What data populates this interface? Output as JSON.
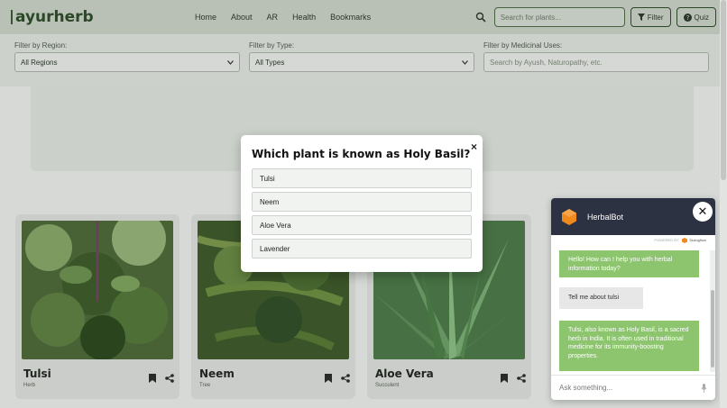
{
  "brand": {
    "name": "ayurherb"
  },
  "nav": {
    "links": [
      "Home",
      "About",
      "AR",
      "Health",
      "Bookmarks"
    ],
    "search_placeholder": "Search for plants...",
    "filter_label": "Filter",
    "quiz_label": "Quiz"
  },
  "filters": {
    "region": {
      "label": "Filter by Region:",
      "value": "All Regions"
    },
    "type": {
      "label": "Filter by Type:",
      "value": "All Types"
    },
    "uses": {
      "label": "Filter by Medicinal Uses:",
      "placeholder": "Search by Ayush, Naturopathy, etc."
    }
  },
  "cards": [
    {
      "name": "Tulsi",
      "type": "Herb"
    },
    {
      "name": "Neem",
      "type": "Tree"
    },
    {
      "name": "Aloe Vera",
      "type": "Succulent"
    }
  ],
  "quiz": {
    "question": "Which plant is known as Holy Basil?",
    "close": "×",
    "options": [
      "Tulsi",
      "Neem",
      "Aloe Vera",
      "Lavender"
    ]
  },
  "chatbot": {
    "title": "HerbalBot",
    "powered_by": "POWERED BY",
    "powered_brand": "Dialogflow",
    "messages": [
      {
        "from": "bot",
        "text": "Hello! How can I help you with herbal information today?"
      },
      {
        "from": "user",
        "text": "Tell me about tulsi"
      },
      {
        "from": "bot",
        "text": "Tulsi, also known as Holy Basil, is a sacred herb in India. It is often used in traditional medicine for its immunity-boosting properties."
      }
    ],
    "input_placeholder": "Ask something..."
  },
  "colors": {
    "accent": "#2f4f2a",
    "chat_header": "#2d3243",
    "bot_bubble": "#8cc56d"
  }
}
